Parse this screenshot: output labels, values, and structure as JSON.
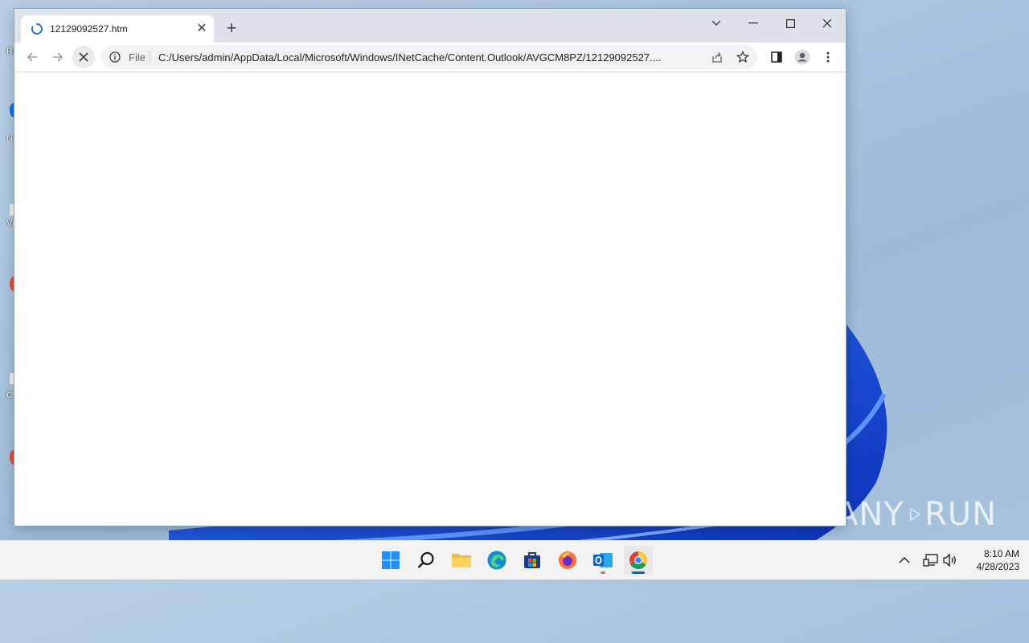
{
  "browser": {
    "tab_title": "12129092527.htm",
    "tab_close": "✕",
    "new_tab": "+",
    "scheme": "File",
    "url": "C:/Users/admin/AppData/Local/Microsoft/Windows/INetCache/Content.Outlook/AVGCM8PZ/12129092527...."
  },
  "desktop": {
    "icon_labels": [
      "Re",
      "N",
      "Vi",
      "C"
    ]
  },
  "watermark": {
    "left": "ANY",
    "right": "RUN"
  },
  "taskbar": {
    "apps": [
      "start-icon",
      "search-icon",
      "file-explorer-icon",
      "edge-icon",
      "store-icon",
      "firefox-icon",
      "outlook-icon",
      "chrome-icon"
    ],
    "time": "8:10 AM",
    "date": "4/28/2023"
  },
  "colors": {
    "accent": "#1a73e8",
    "desktop_blue": "#1a4fd8"
  }
}
